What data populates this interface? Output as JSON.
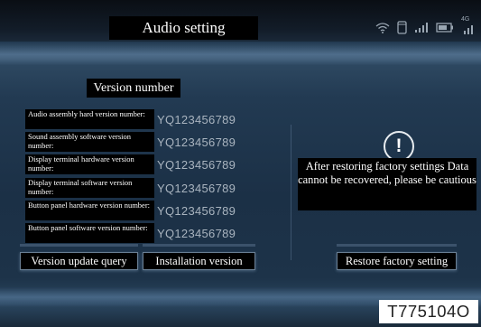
{
  "header": {
    "title": "Audio setting",
    "status_icons": [
      "wifi-icon",
      "phone-icon",
      "signal-icon",
      "battery-icon",
      "4g-signal-icon"
    ],
    "network_label": "4G"
  },
  "version_panel": {
    "title": "Version number",
    "rows": [
      {
        "label": "Audio assembly hard version number:",
        "value": "YQ123456789"
      },
      {
        "label": "Sound assembly software version number:",
        "value": "YQ123456789"
      },
      {
        "label": "Display terminal hardware version number:",
        "value": "YQ123456789"
      },
      {
        "label": "Display terminal software version number:",
        "value": "YQ123456789"
      },
      {
        "label": "Button panel hardware version number:",
        "value": "YQ123456789"
      },
      {
        "label": "Button panel software version number:",
        "value": "YQ123456789"
      }
    ]
  },
  "warning": {
    "icon": "exclamation-icon",
    "text": "After restoring factory settings Data cannot be recovered, please be cautious"
  },
  "buttons": {
    "version_update": "Version update query",
    "installation": "Installation version",
    "restore": "Restore factory setting"
  },
  "figure_code": "T775104O"
}
